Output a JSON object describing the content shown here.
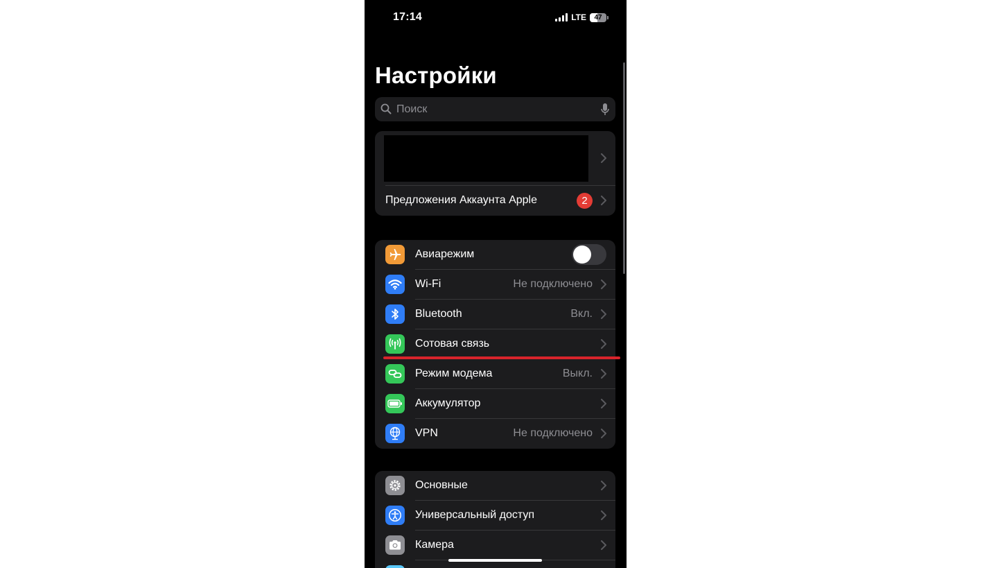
{
  "status_bar": {
    "time": "17:14",
    "network": "LTE",
    "battery": "47",
    "battery_level": 0.47
  },
  "page": {
    "title": "Настройки"
  },
  "search": {
    "placeholder": "Поиск"
  },
  "account": {
    "suggestions_label": "Предложения Аккаунта Apple",
    "suggestions_badge": "2"
  },
  "connectivity": [
    {
      "label": "Авиарежим",
      "value": "",
      "icon": "airplane-icon",
      "color": "#f19a37",
      "toggle": false
    },
    {
      "label": "Wi-Fi",
      "value": "Не подключено",
      "icon": "wifi-icon",
      "color": "#2f7df6"
    },
    {
      "label": "Bluetooth",
      "value": "Вкл.",
      "icon": "bluetooth-icon",
      "color": "#2f7df6"
    },
    {
      "label": "Сотовая связь",
      "value": "",
      "icon": "antenna-icon",
      "color": "#34c759"
    },
    {
      "label": "Режим модема",
      "value": "Выкл.",
      "icon": "hotspot-icon",
      "color": "#34c759"
    },
    {
      "label": "Аккумулятор",
      "value": "",
      "icon": "battery-icon",
      "color": "#34c759"
    },
    {
      "label": "VPN",
      "value": "Не подключено",
      "icon": "globe-icon",
      "color": "#2f7df6"
    }
  ],
  "general": [
    {
      "label": "Основные",
      "icon": "gear-icon",
      "color": "#8e8e93"
    },
    {
      "label": "Универсальный доступ",
      "icon": "accessibility-icon",
      "color": "#2f7df6"
    },
    {
      "label": "Камера",
      "icon": "camera-icon",
      "color": "#8e8e93"
    }
  ]
}
